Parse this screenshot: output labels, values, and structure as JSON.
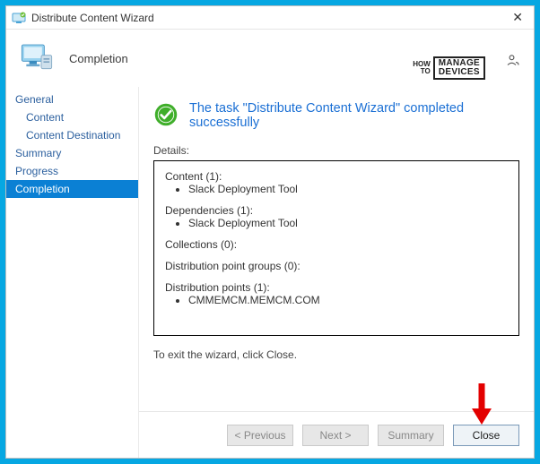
{
  "window": {
    "title": "Distribute Content Wizard",
    "close_glyph": "✕"
  },
  "header": {
    "page_title": "Completion",
    "watermark_left_l1": "HOW",
    "watermark_left_l2": "TO",
    "watermark_right_l1": "MANAGE",
    "watermark_right_l2": "DEVICES"
  },
  "sidebar": {
    "items": [
      {
        "label": "General",
        "child": false,
        "selected": false
      },
      {
        "label": "Content",
        "child": true,
        "selected": false
      },
      {
        "label": "Content Destination",
        "child": true,
        "selected": false
      },
      {
        "label": "Summary",
        "child": false,
        "selected": false
      },
      {
        "label": "Progress",
        "child": false,
        "selected": false
      },
      {
        "label": "Completion",
        "child": false,
        "selected": true
      }
    ]
  },
  "main": {
    "success_message": "The task \"Distribute Content Wizard\" completed successfully",
    "details_label": "Details:",
    "details": [
      {
        "heading": "Content (1):",
        "items": [
          "Slack Deployment Tool"
        ]
      },
      {
        "heading": "Dependencies (1):",
        "items": [
          "Slack Deployment Tool"
        ]
      },
      {
        "heading": "Collections (0):",
        "items": []
      },
      {
        "heading": "Distribution point groups (0):",
        "items": []
      },
      {
        "heading": "Distribution points (1):",
        "items": [
          "CMMEMCM.MEMCM.COM"
        ]
      }
    ],
    "exit_text": "To exit the wizard, click Close."
  },
  "footer": {
    "previous": "< Previous",
    "next": "Next >",
    "summary": "Summary",
    "close": "Close"
  }
}
